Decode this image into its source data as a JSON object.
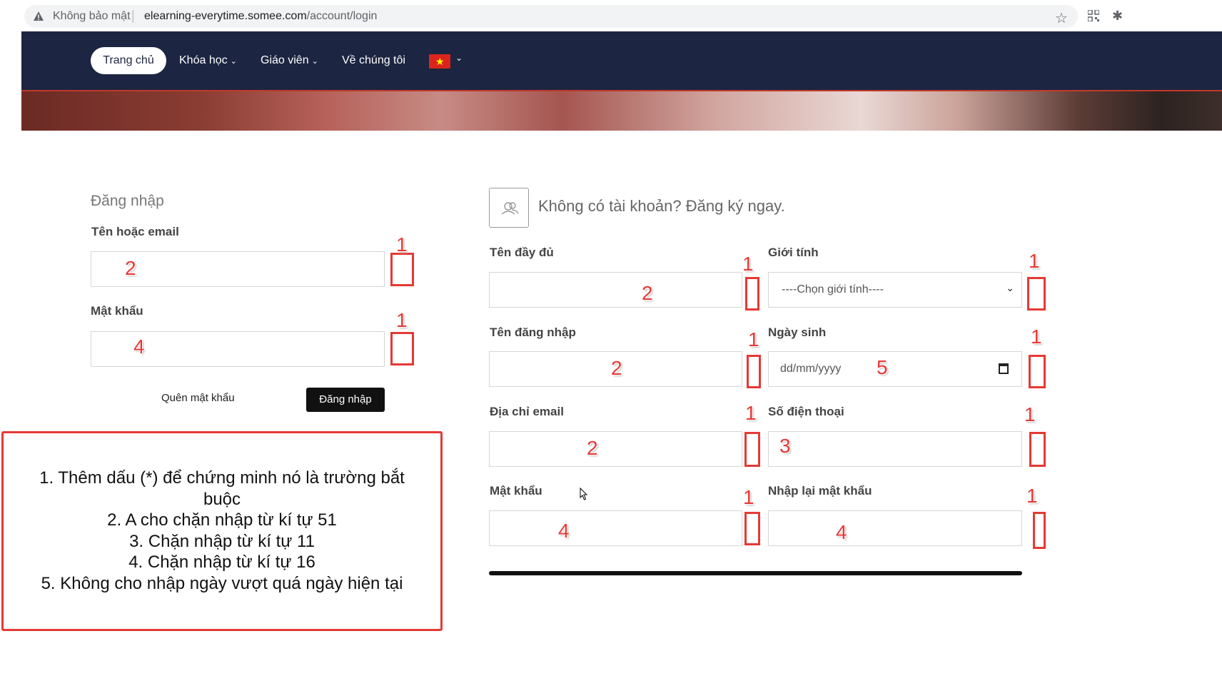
{
  "browser": {
    "insecure_label": "Không bảo mật",
    "separator": "|",
    "url_host": "elearning-everytime.somee.com",
    "url_path": "/account/login"
  },
  "nav": {
    "home": "Trang chủ",
    "courses": "Khóa học",
    "teachers": "Giáo viên",
    "about": "Về chúng tôi",
    "language_flag": "vietnam-flag-icon"
  },
  "login": {
    "title": "Đăng nhập",
    "username_label": "Tên hoặc email",
    "password_label": "Mật khẩu",
    "forgot_link": "Quên mật khẩu",
    "submit_label": "Đăng nhập"
  },
  "register": {
    "title": "Không có tài khoản? Đăng ký ngay.",
    "fullname_label": "Tên đầy đủ",
    "gender_label": "Giới tính",
    "gender_selected": "----Chọn giới tính----",
    "username_label": "Tên đăng nhập",
    "birthday_label": "Ngày sinh",
    "birthday_placeholder": "dd/mm/yyyy",
    "email_label": "Địa chỉ email",
    "phone_label": "Số điện thoại",
    "password_label": "Mật khẩu",
    "confirm_label": "Nhập lại mật khẩu"
  },
  "annotations": {
    "marker_one": "1",
    "marker_two": "2",
    "marker_three": "3",
    "marker_four": "4",
    "marker_five": "5",
    "notes": [
      "1. Thêm dấu (*) để chứng minh nó là trường bắt buộc",
      "2. A cho chặn nhập từ kí tự 51",
      "3. Chặn nhập từ kí tự 11",
      "4. Chặn nhập từ kí tự 16",
      "5. Không cho nhập ngày vượt quá ngày hiện tại"
    ],
    "color": "#e53935"
  },
  "colors": {
    "navbar": "#1c2541",
    "accent": "#c0392b",
    "button": "#111111"
  }
}
